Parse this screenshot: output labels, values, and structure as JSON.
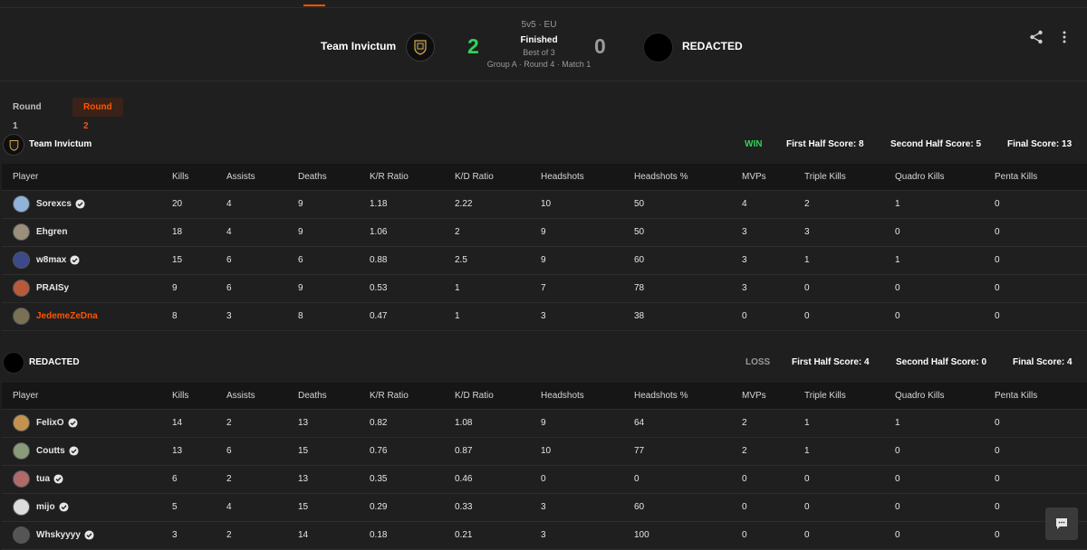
{
  "colors": {
    "accent": "#ff5500",
    "win": "#32d35a",
    "loss": "#9a9a9a",
    "background": "#1f1f1f",
    "table_header": "#161616"
  },
  "match": {
    "team_left": "Team Invictum",
    "team_right": "REDACTED",
    "score_left": "2",
    "score_right": "0",
    "format": "5v5 · EU",
    "status": "Finished",
    "best_of": "Best of 3",
    "group_info": "Group A · Round 4 · Match 1",
    "icons": {
      "share": "share-icon",
      "more": "more-vertical-icon",
      "chat": "chat-icon"
    }
  },
  "rounds": {
    "tab1": "Round 1",
    "tab2": "Round 2",
    "selected": "Round 2"
  },
  "columns": [
    "Player",
    "Kills",
    "Assists",
    "Deaths",
    "K/R Ratio",
    "K/D Ratio",
    "Headshots",
    "Headshots %",
    "MVPs",
    "Triple Kills",
    "Quadro Kills",
    "Penta Kills"
  ],
  "team1": {
    "name": "Team Invictum",
    "result": "WIN",
    "first_half": "First Half Score: 8",
    "second_half": "Second Half Score: 5",
    "final": "Final Score: 13",
    "players": [
      {
        "name": "Sorexcs",
        "verified": true,
        "highlight": false,
        "avatar_color": "#8fb3d9",
        "stats": [
          "20",
          "4",
          "9",
          "1.18",
          "2.22",
          "10",
          "50",
          "4",
          "2",
          "1",
          "0"
        ]
      },
      {
        "name": "Ehgren",
        "verified": false,
        "highlight": false,
        "avatar_color": "#9a8f7a",
        "stats": [
          "18",
          "4",
          "9",
          "1.06",
          "2",
          "9",
          "50",
          "3",
          "3",
          "0",
          "0"
        ]
      },
      {
        "name": "w8max",
        "verified": true,
        "highlight": false,
        "avatar_color": "#3b4a8a",
        "stats": [
          "15",
          "6",
          "6",
          "0.88",
          "2.5",
          "9",
          "60",
          "3",
          "1",
          "1",
          "0"
        ]
      },
      {
        "name": "PRAISy",
        "verified": false,
        "highlight": false,
        "avatar_color": "#b85a3a",
        "stats": [
          "9",
          "6",
          "9",
          "0.53",
          "1",
          "7",
          "78",
          "3",
          "0",
          "0",
          "0"
        ]
      },
      {
        "name": "JedemeZeDna",
        "verified": false,
        "highlight": true,
        "avatar_color": "#7a7055",
        "stats": [
          "8",
          "3",
          "8",
          "0.47",
          "1",
          "3",
          "38",
          "0",
          "0",
          "0",
          "0"
        ]
      }
    ]
  },
  "team2": {
    "name": "REDACTED",
    "result": "LOSS",
    "first_half": "First Half Score: 4",
    "second_half": "Second Half Score: 0",
    "final": "Final Score: 4",
    "players": [
      {
        "name": "FelixO",
        "verified": true,
        "highlight": false,
        "avatar_color": "#c4924f",
        "stats": [
          "14",
          "2",
          "13",
          "0.82",
          "1.08",
          "9",
          "64",
          "2",
          "1",
          "1",
          "0"
        ]
      },
      {
        "name": "Coutts",
        "verified": true,
        "highlight": false,
        "avatar_color": "#8a9a7a",
        "stats": [
          "13",
          "6",
          "15",
          "0.76",
          "0.87",
          "10",
          "77",
          "2",
          "1",
          "0",
          "0"
        ]
      },
      {
        "name": "tua",
        "verified": true,
        "highlight": false,
        "avatar_color": "#b06a6a",
        "stats": [
          "6",
          "2",
          "13",
          "0.35",
          "0.46",
          "0",
          "0",
          "0",
          "0",
          "0",
          "0"
        ]
      },
      {
        "name": "mijo",
        "verified": true,
        "highlight": false,
        "avatar_color": "#dcdcdc",
        "stats": [
          "5",
          "4",
          "15",
          "0.29",
          "0.33",
          "3",
          "60",
          "0",
          "0",
          "0",
          "0"
        ]
      },
      {
        "name": "Whskyyyy",
        "verified": true,
        "highlight": false,
        "avatar_color": "#555555",
        "stats": [
          "3",
          "2",
          "14",
          "0.18",
          "0.21",
          "3",
          "100",
          "0",
          "0",
          "0",
          "0"
        ]
      }
    ]
  }
}
